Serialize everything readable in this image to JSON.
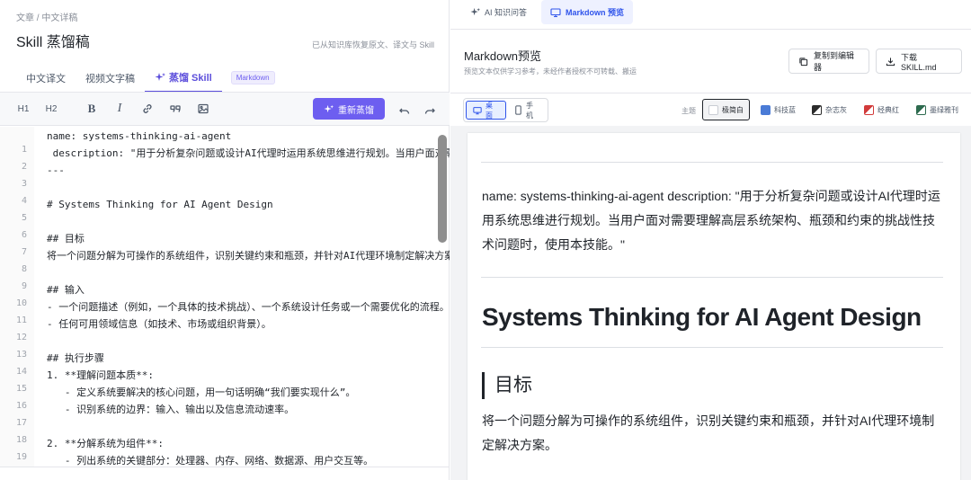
{
  "left": {
    "breadcrumb": "文章 / 中文详稿",
    "title": "Skill 蒸馏稿",
    "restore_note": "已从知识库恢复原文、译文与 Skill",
    "tabs": [
      {
        "label": "中文译文"
      },
      {
        "label": "视频文字稿"
      },
      {
        "label": "蒸馏 Skill"
      }
    ],
    "badge": "Markdown",
    "toolbar": {
      "h1": "H1",
      "h2": "H2",
      "bold": "B",
      "italic": "I",
      "regen_label": "重新蒸馏",
      "icons": [
        "bold-icon",
        "italic-icon",
        "link-icon",
        "quote-icon",
        "image-icon",
        "undo-icon",
        "redo-icon",
        "sparkle-icon"
      ]
    },
    "line_numbers": [
      "1",
      "2",
      "3",
      "4",
      "5",
      "6",
      "7",
      "8",
      "9",
      "10",
      "11",
      "12",
      "13",
      "14",
      "15",
      "16",
      "17",
      "18",
      "19"
    ],
    "code_lines": [
      "name: systems-thinking-ai-agent",
      " description: \"用于分析复杂问题或设计AI代理时运用系统思维进行规划。当用户面对需要理解高层系统架构、瓶颈和约束的挑战性技术问题时，使用本技能。\"",
      "---",
      "",
      "# Systems Thinking for AI Agent Design",
      "",
      "## 目标",
      "将一个问题分解为可操作的系统组件，识别关键约束和瓶颈，并针对AI代理环境制定解决方案。",
      "",
      "## 输入",
      "- 一个问题描述（例如，一个具体的技术挑战）、一个系统设计任务或一个需要优化的流程。",
      "- 任何可用领域信息（如技术、市场或组织背景）。",
      "",
      "## 执行步骤",
      "1. **理解问题本质**:",
      "   - 定义系统要解决的核心问题，用一句话明确“我们要实现什么”。",
      "   - 识别系统的边界：输入、输出以及信息流动速率。",
      "",
      "2. **分解系统为组件**:",
      "   - 列出系统的关键部分：处理器、内存、网络、数据源、用户交互等。"
    ]
  },
  "right": {
    "tabs": [
      {
        "label": "AI 知识问答"
      },
      {
        "label": "Markdown 预览"
      }
    ],
    "preview_title": "Markdown预览",
    "preview_subtitle": "预览文本仅供学习参考，未经作者授权不可转载、搬运",
    "copy_label": "复制到编辑器",
    "download_label": "下载 SKILL.md",
    "devices": [
      {
        "label": "桌面"
      },
      {
        "label": "手机"
      }
    ],
    "theme_label": "主题",
    "themes": [
      {
        "label": "极简白",
        "color": "#ffffff"
      },
      {
        "label": "科技蓝",
        "color": "#4a7bd6"
      },
      {
        "label": "杂志灰",
        "color": "#2b2b2b"
      },
      {
        "label": "经典红",
        "color": "#d23b3b"
      },
      {
        "label": "墨绿雅刊",
        "color": "#2e6b4f"
      }
    ],
    "accent": "#6d5ef0",
    "preview": {
      "frontmatter": "name: systems-thinking-ai-agent description: \"用于分析复杂问题或设计AI代理时运用系统思维进行规划。当用户面对需要理解高层系统架构、瓶颈和约束的挑战性技术问题时，使用本技能。\"",
      "h1": "Systems Thinking for AI Agent Design",
      "h2": "目标",
      "body": "将一个问题分解为可操作的系统组件，识别关键约束和瓶颈，并针对AI代理环境制定解决方案。"
    }
  }
}
